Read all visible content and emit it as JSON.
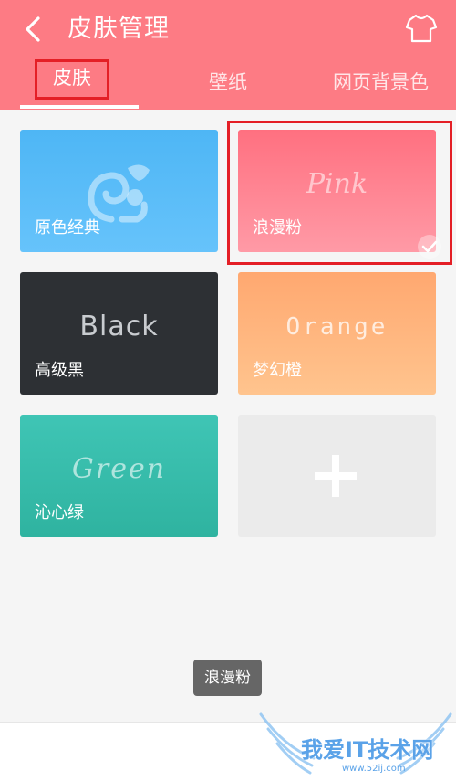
{
  "header": {
    "title": "皮肤管理",
    "back_icon": "chevron-left-icon",
    "shirt_icon": "shirt-icon",
    "background_color": "#fd7b84"
  },
  "tabs": [
    {
      "label": "皮肤",
      "active": true
    },
    {
      "label": "壁纸",
      "active": false
    },
    {
      "label": "网页背景色",
      "active": false
    }
  ],
  "skins": [
    {
      "label": "原色经典",
      "art": "",
      "icon": "squirrel-icon",
      "selected": false
    },
    {
      "label": "浪漫粉",
      "art": "Pink",
      "selected": true
    },
    {
      "label": "高级黑",
      "art": "Black",
      "selected": false
    },
    {
      "label": "梦幻橙",
      "art": "Orange",
      "selected": false
    },
    {
      "label": "沁心绿",
      "art": "Green",
      "selected": false
    }
  ],
  "add_skin": {
    "icon": "plus-icon"
  },
  "toast": {
    "text": "浪漫粉"
  },
  "watermark": {
    "text": "我爱IT技术网",
    "url": "www.52ij.com"
  },
  "colors": {
    "highlight": "#e41f26",
    "classic": "#4eb6f5",
    "pink": "#ff7080",
    "black": "#2d3034",
    "orange": "#ffa870",
    "green": "#3fc5b5"
  }
}
